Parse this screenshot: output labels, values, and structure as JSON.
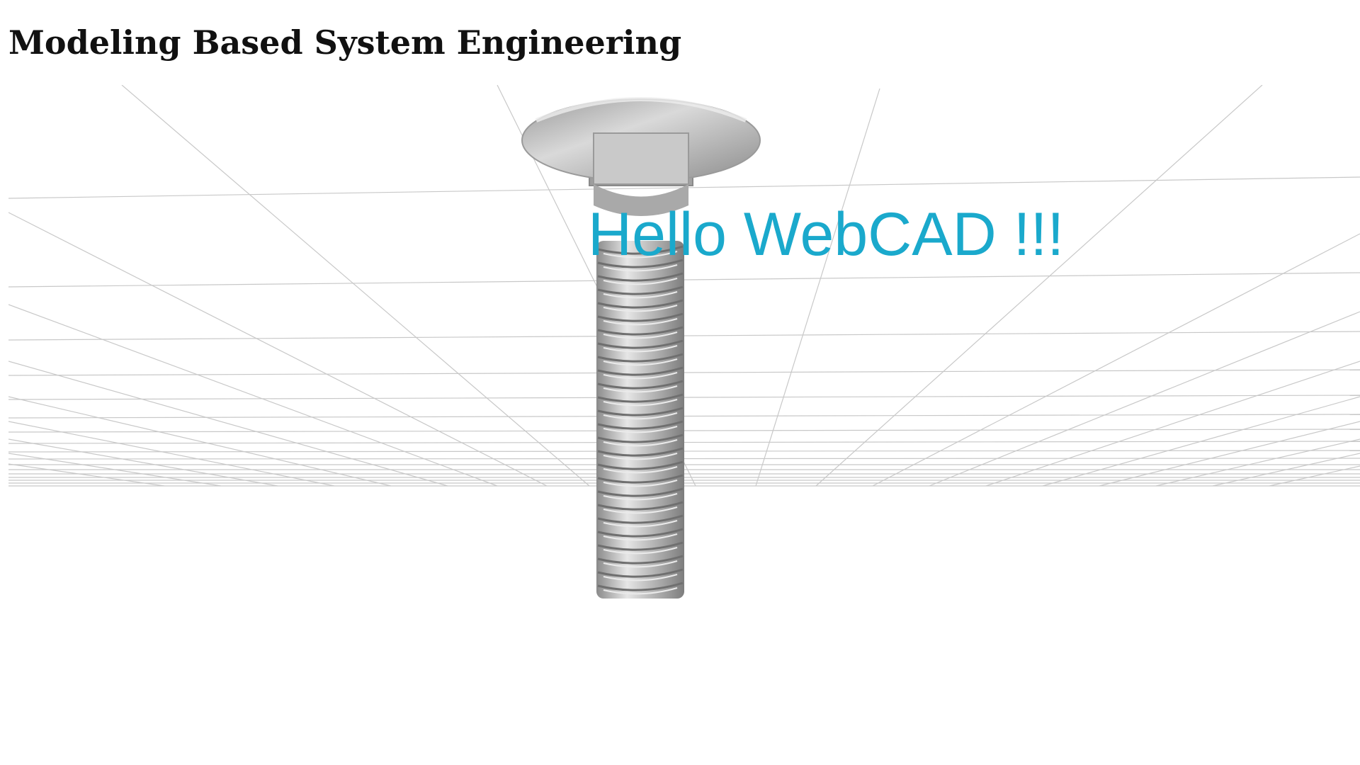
{
  "page": {
    "title": "Modeling Based System Engineering"
  },
  "viewport": {
    "overlay_text": "Hello WebCAD !!!",
    "overlay_color": "#1aa9cc",
    "grid_color": "#c8c8c8",
    "model_color": "#bdbdbd"
  }
}
